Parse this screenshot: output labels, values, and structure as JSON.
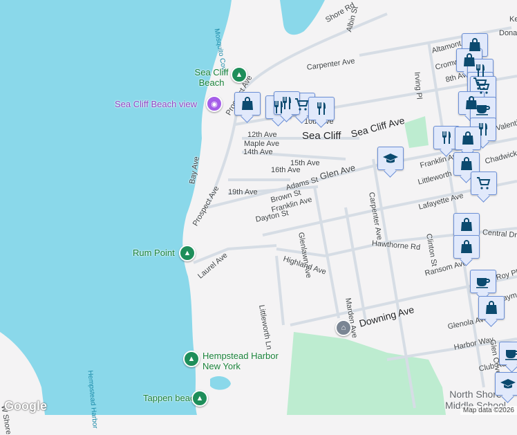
{
  "map": {
    "place_title": "Sea Cliff",
    "streets": [
      "Shore Rd",
      "Albin St",
      "Carpenter Ave",
      "Altamont",
      "Cromwell",
      "Irving Pl",
      "8th Ave",
      "Donald",
      "Kent",
      "10th Ave",
      "12th Ave",
      "Maple Ave",
      "14th Ave",
      "15th Ave",
      "16th Ave",
      "19th Ave",
      "Sea Cliff Ave",
      "Glen Ave",
      "Adams St",
      "Brown St",
      "Franklin Ave",
      "Dayton St",
      "Glenlawn Ave",
      "Prospect Ave",
      "Bay Ave",
      "Laurel Ave",
      "Highland Ave",
      "Littleworth Ln",
      "Marden Ave",
      "Hawthorne Rd",
      "Carpenter Ave",
      "Franklin Ave",
      "Littleworth Ln",
      "Chadwick St",
      "Lafayette Ave",
      "Clinton St",
      "Central Dr",
      "Ransom Ave",
      "Downing Ave",
      "Glenola Ave",
      "Harbor Way",
      "Club Rd",
      "Valentine Ave",
      "Roy Pl",
      "Raymond",
      "Glen Cove Ave",
      "Prospect Ave"
    ],
    "water_labels": [
      "Mosquito Cove",
      "Hempstead Harbor"
    ],
    "pois": [
      {
        "name": "Sea Cliff Beach",
        "icon": "park-icon",
        "color": "#1e8e5a"
      },
      {
        "name": "Sea Cliff Beach view",
        "icon": "camera-icon",
        "color": "#a55ee8"
      },
      {
        "name": "Rum Point",
        "icon": "park-icon",
        "color": "#1e8e5a"
      },
      {
        "name": "Hempstead Harbor New York",
        "icon": "park-icon",
        "color": "#1e8e5a"
      },
      {
        "name": "Tappen beach",
        "icon": "park-icon",
        "color": "#1e8e5a"
      },
      {
        "name": "North Shore Middle School",
        "icon": "school-icon",
        "color": "#5f6368"
      }
    ],
    "other_labels": [
      "W Shore"
    ],
    "markers": [
      "shopping-bag",
      "restaurant",
      "shopping-cart",
      "restaurant",
      "restaurant",
      "shopping-bag",
      "shopping-bag",
      "restaurant",
      "shopping-cart",
      "shopping-cart",
      "shopping-bag",
      "coffee",
      "restaurant",
      "restaurant",
      "shopping-bag",
      "school",
      "shopping-bag",
      "shopping-cart",
      "shopping-bag",
      "shopping-bag",
      "coffee",
      "shopping-bag",
      "coffee",
      "school"
    ],
    "colors": {
      "water": "#8ad8ea",
      "land": "#f4f3f4",
      "park": "#bdecd0",
      "road": "#d6dde5",
      "marker_fill": "#e1e9fb",
      "marker_border": "#6b8fd6",
      "icon": "#0b4a6f"
    }
  },
  "footer": {
    "logo": "Google",
    "attribution": "Map data ©2026"
  }
}
